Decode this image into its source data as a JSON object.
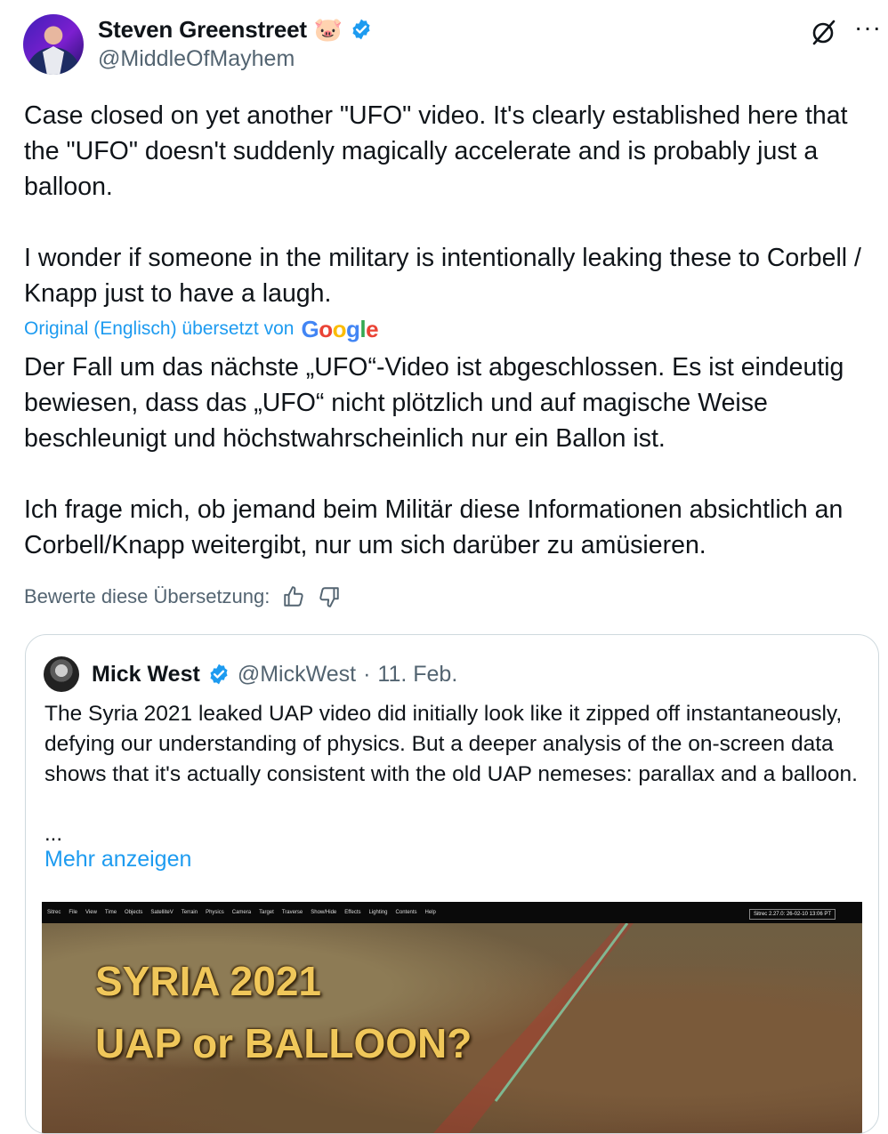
{
  "author": {
    "display_name": "Steven Greenstreet",
    "emoji": "🐷",
    "handle": "@MiddleOfMayhem"
  },
  "tweet": {
    "text": "Case closed on yet another \"UFO\" video. It's clearly established here that the \"UFO\" doesn't suddenly magically accelerate and is probably just a balloon.\n\nI wonder if someone in the military is intentionally leaking these to Corbell / Knapp just to have a laugh.",
    "translated_by_label": "Original (Englisch) übersetzt von",
    "translation_provider": "Google",
    "translation": "Der Fall um das nächste „UFO“-Video ist abgeschlossen. Es ist eindeutig bewiesen, dass das „UFO“ nicht plötzlich und auf magische Weise beschleunigt und höchstwahrscheinlich nur ein Ballon ist.\n\nIch frage mich, ob jemand beim Militär diese Informationen absichtlich an Corbell/Knapp weitergibt, nur um sich darüber zu amüsieren.",
    "rate_label": "Bewerte diese Übersetzung:"
  },
  "quote": {
    "display_name": "Mick West",
    "handle": "@MickWest",
    "separator": "·",
    "date": "11. Feb.",
    "text": "The Syria 2021 leaked UAP video did initially look like it zipped off instantaneously, defying our understanding of physics. But a deeper analysis of the on-screen data shows that it's actually consistent with the old UAP nemeses: parallax and a balloon.",
    "ellipsis": "...",
    "show_more": "Mehr anzeigen",
    "video": {
      "menu_items": [
        "Sitrec",
        "File",
        "View",
        "Time",
        "Objects",
        "SatelliteV",
        "Terrain",
        "Physics",
        "Camera",
        "Target",
        "Traverse",
        "Show/Hide",
        "Effects",
        "Lighting",
        "Contents",
        "Help"
      ],
      "status": "Sitrec 2.27.0: 26-02-10 13:06 PT",
      "title_line1": "SYRIA 2021",
      "title_line2": "UAP or BALLOON?"
    }
  },
  "colors": {
    "accent": "#1d9bf0",
    "secondary_text": "#536471",
    "title_gold": "#f0c75a"
  },
  "icons": [
    "verified-badge-icon",
    "grok-icon",
    "more-options-icon",
    "thumbs-up-icon",
    "thumbs-down-icon"
  ]
}
